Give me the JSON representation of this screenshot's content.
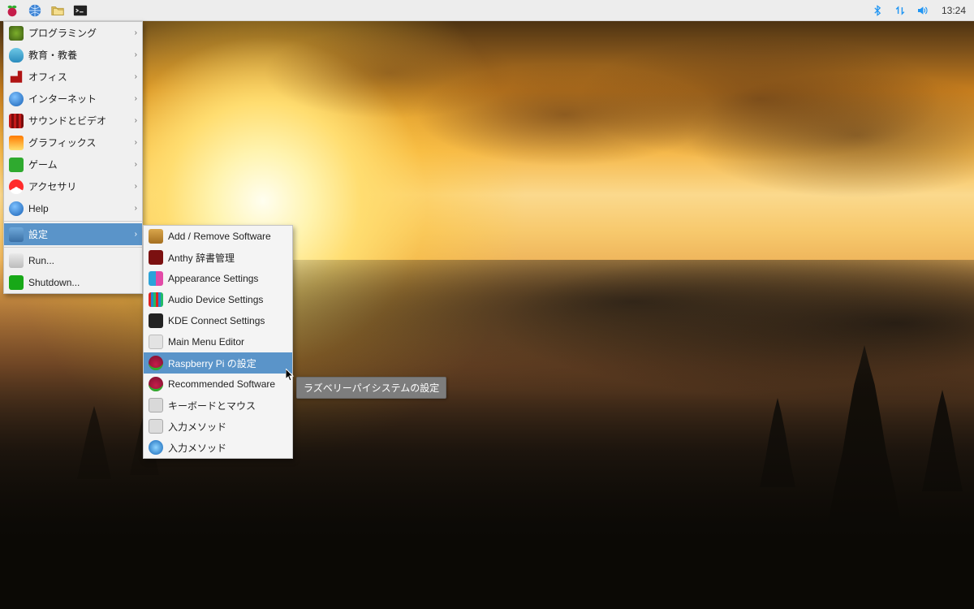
{
  "taskbar": {
    "left_icons": [
      "raspberry-icon",
      "globe-icon",
      "files-icon",
      "terminal-icon"
    ],
    "right_icons": [
      "bluetooth-icon",
      "network-icon",
      "volume-icon"
    ],
    "clock": "13:24"
  },
  "menu": {
    "items": [
      {
        "icon": "ic-programming",
        "name": "menu-programming",
        "label": "プログラミング",
        "submenu": true
      },
      {
        "icon": "ic-education",
        "name": "menu-education",
        "label": "教育・教養",
        "submenu": true
      },
      {
        "icon": "ic-office",
        "name": "menu-office",
        "label": "オフィス",
        "submenu": true
      },
      {
        "icon": "ic-internet",
        "name": "menu-internet",
        "label": "インターネット",
        "submenu": true
      },
      {
        "icon": "ic-soundvideo",
        "name": "menu-sound-video",
        "label": "サウンドとビデオ",
        "submenu": true
      },
      {
        "icon": "ic-graphics",
        "name": "menu-graphics",
        "label": "グラフィックス",
        "submenu": true
      },
      {
        "icon": "ic-games",
        "name": "menu-games",
        "label": "ゲーム",
        "submenu": true
      },
      {
        "icon": "ic-accessory",
        "name": "menu-accessories",
        "label": "アクセサリ",
        "submenu": true
      },
      {
        "icon": "ic-help",
        "name": "menu-help",
        "label": "Help",
        "submenu": true
      }
    ],
    "preferences": {
      "icon": "ic-preferences",
      "name": "menu-preferences",
      "label": "設定",
      "submenu": true,
      "selected": true
    },
    "run": {
      "icon": "ic-run",
      "name": "menu-run",
      "label": "Run...",
      "submenu": false
    },
    "shutdown": {
      "icon": "ic-shutdown",
      "name": "menu-shutdown",
      "label": "Shutdown...",
      "submenu": false
    }
  },
  "submenu": {
    "items": [
      {
        "icon": "ic-addremove",
        "name": "submenu-add-remove-software",
        "label": "Add / Remove Software"
      },
      {
        "icon": "ic-anthy",
        "name": "submenu-anthy-dict",
        "label": "Anthy 辞書管理"
      },
      {
        "icon": "ic-appearance",
        "name": "submenu-appearance-settings",
        "label": "Appearance Settings"
      },
      {
        "icon": "ic-audio",
        "name": "submenu-audio-device-settings",
        "label": "Audio Device Settings"
      },
      {
        "icon": "ic-kde",
        "name": "submenu-kde-connect-settings",
        "label": "KDE Connect Settings"
      },
      {
        "icon": "ic-mainmenu",
        "name": "submenu-main-menu-editor",
        "label": "Main Menu Editor"
      },
      {
        "icon": "ic-rpi",
        "name": "submenu-raspberry-pi-config",
        "label": "Raspberry Pi の設定",
        "selected": true
      },
      {
        "icon": "ic-recommended",
        "name": "submenu-recommended-software",
        "label": "Recommended Software"
      },
      {
        "icon": "ic-keyboard",
        "name": "submenu-keyboard-mouse",
        "label": "キーボードとマウス"
      },
      {
        "icon": "ic-inputmethod1",
        "name": "submenu-input-method-1",
        "label": "入力メソッド"
      },
      {
        "icon": "ic-inputmethod2",
        "name": "submenu-input-method-2",
        "label": "入力メソッド"
      }
    ]
  },
  "tooltip": "ラズベリーパイシステムの設定"
}
